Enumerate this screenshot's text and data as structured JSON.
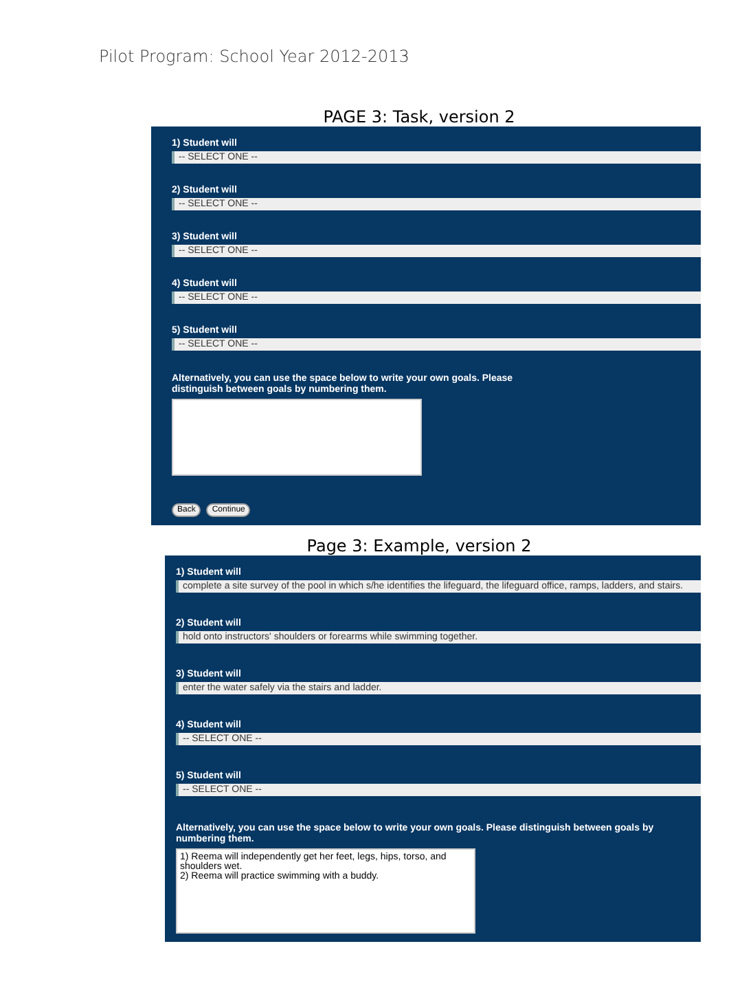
{
  "header": "Pilot Program: School Year 2012-2013",
  "sections": [
    {
      "title": "PAGE 3: Task, version 2",
      "goals": [
        {
          "label": "1) Student will",
          "value": "-- SELECT ONE --"
        },
        {
          "label": "2) Student will",
          "value": "-- SELECT ONE --"
        },
        {
          "label": "3) Student will",
          "value": "-- SELECT ONE --"
        },
        {
          "label": "4) Student will",
          "value": "-- SELECT ONE --"
        },
        {
          "label": "5) Student will",
          "value": "-- SELECT ONE --"
        }
      ],
      "instructions": "Alternatively, you can use the space below to write your own goals. Please distinguish between goals by numbering them.",
      "text_box": true,
      "buttons": [
        "Back",
        "Continue"
      ]
    },
    {
      "title": "Page 3: Example, version 2",
      "goals": [
        {
          "label": "1) Student will",
          "value": "complete a site survey of the pool in which s/he identifies the lifeguard, the lifeguard office, ramps, ladders, and stairs."
        },
        {
          "label": "2) Student will",
          "value": "hold onto instructors' shoulders or forearms while swimming together."
        },
        {
          "label": "3) Student will",
          "value": "enter the water safely via the stairs and ladder."
        },
        {
          "label": "4) Student will",
          "value": "-- SELECT ONE --"
        },
        {
          "label": "5) Student will",
          "value": "-- SELECT ONE --"
        }
      ],
      "instructions": "Alternatively, you can use the space below to write your own goals. Please distinguish between goals by numbering them.",
      "textarea": {
        "value": "1) Reema will independently get her feet, legs, hips, torso, and shoulders wet.\n2) Reema will practice swimming with a buddy."
      }
    }
  ]
}
